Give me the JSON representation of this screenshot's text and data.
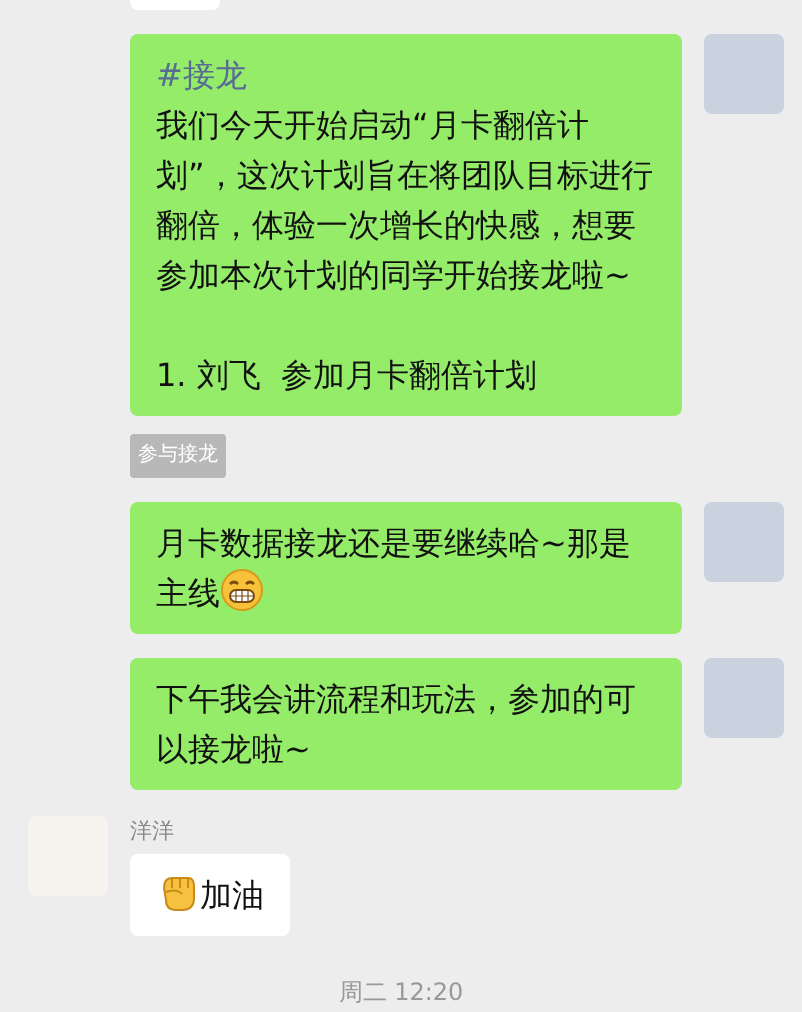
{
  "partial_bubble_above": true,
  "items": [
    {
      "kind": "message",
      "outgoing": true,
      "hashtag": "#接龙",
      "text": "我们今天开始启动“月卡翻倍计划”，这次计划旨在将团队目标进行翻倍，体验一次增长的快感，想要参加本次计划的同学开始接龙啦~",
      "list_items": [
        "1. 刘飞  参加月卡翻倍计划"
      ]
    },
    {
      "kind": "tag",
      "text": "参与接龙"
    },
    {
      "kind": "message",
      "outgoing": true,
      "text": "月卡数据接龙还是要继续哈~那是主线",
      "emoji": {
        "kind": "grin",
        "leading": false
      }
    },
    {
      "kind": "message",
      "outgoing": true,
      "text": "下午我会讲流程和玩法，参加的可以接龙啦~"
    },
    {
      "kind": "message",
      "outgoing": false,
      "name": "洋洋",
      "text": "加油",
      "emoji": {
        "kind": "fist",
        "leading": true
      }
    },
    {
      "kind": "time",
      "text": "周二 12:20"
    }
  ]
}
